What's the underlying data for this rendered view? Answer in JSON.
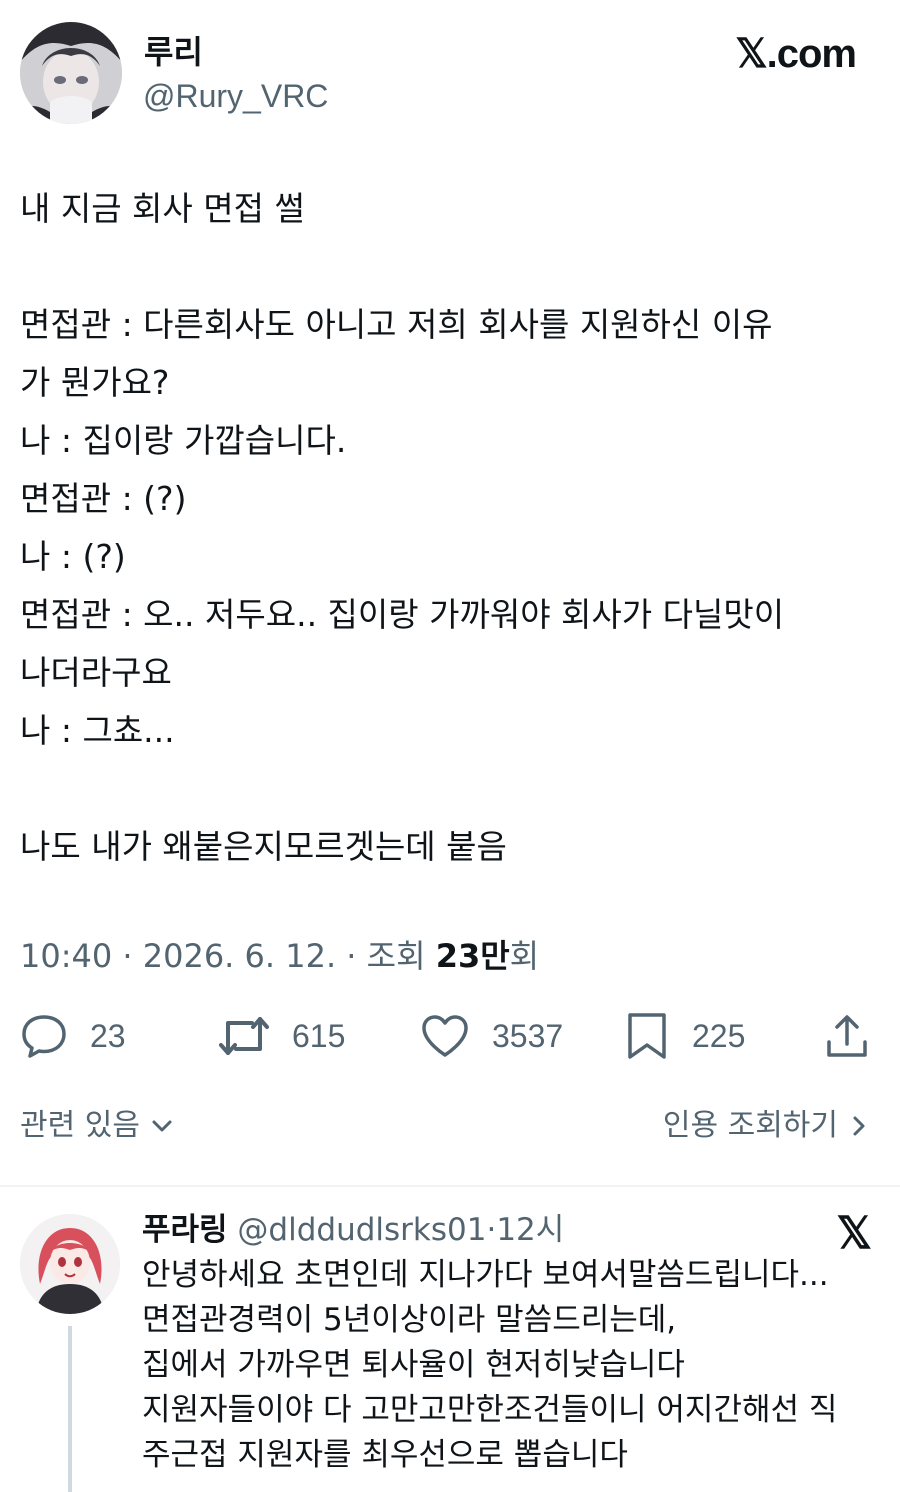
{
  "author": {
    "name": "루리",
    "handle": "@Rury_VRC"
  },
  "brand": "𝕏.com",
  "tweet_lines": [
    "내 지금 회사 면접 썰",
    "",
    "면접관 : 다른회사도 아니고 저희 회사를 지원하신 이유",
    "가 뭔가요?",
    "나 : 집이랑 가깝습니다.",
    "면접관 : (?)",
    "나 : (?)",
    "면접관 : 오.. 저두요.. 집이랑 가까워야 회사가 다닐맛이",
    "나더라구요",
    "나 : 그쵸...",
    "",
    "나도 내가 왜붙은지모르겟는데 붙음"
  ],
  "meta": {
    "time": "10:40",
    "date": "2026. 6. 12.",
    "views_prefix": "조회",
    "views_number": "23만",
    "views_suffix": "회",
    "separator": "·"
  },
  "actions": {
    "replies": "23",
    "retweets": "615",
    "likes": "3537",
    "bookmarks": "225"
  },
  "related": {
    "label": "관련 있음",
    "quote_views": "인용 조회하기"
  },
  "reply": {
    "name": "푸라링",
    "handle": "@dlddudlsrks01",
    "separator": "·",
    "time": "12시",
    "x_logo": "𝕏",
    "lines": [
      "안녕하세요 초면인데 지나가다 보여서말씀드립니다...",
      "면접관경력이 5년이상이라 말씀드리는데,",
      "집에서 가까우면 퇴사율이 현저히낮습니다",
      "지원자들이야 다 고만고만한조건들이니 어지간해선 직",
      "주근접 지원자를 최우선으로 뽑습니다"
    ]
  },
  "colors": {
    "text": "#0f1419",
    "secondary": "#536471",
    "divider": "#eff3f4"
  }
}
